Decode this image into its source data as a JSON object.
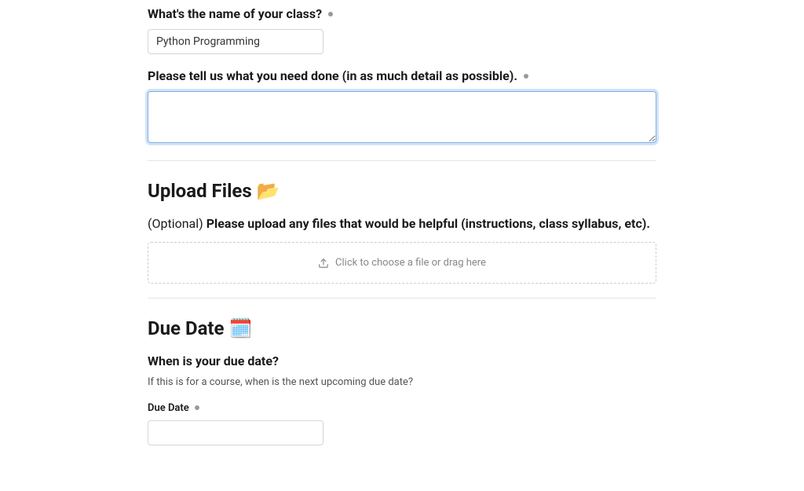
{
  "class_name": {
    "label": "What's the name of your class?",
    "value": "Python Programming"
  },
  "details": {
    "label": "Please tell us what you need done (in as much detail as possible).",
    "value": ""
  },
  "upload": {
    "heading": "Upload Files 📂",
    "optional_text": "(Optional) ",
    "instruction": "Please upload any files that would be helpful (instructions, class syllabus, etc).",
    "dropzone_text": "Click to choose a file or drag here"
  },
  "due_date": {
    "heading": "Due Date 🗓️",
    "question": "When is your due date?",
    "helper": "If this is for a course, when is the next upcoming due date?",
    "label": "Due Date",
    "value": ""
  }
}
